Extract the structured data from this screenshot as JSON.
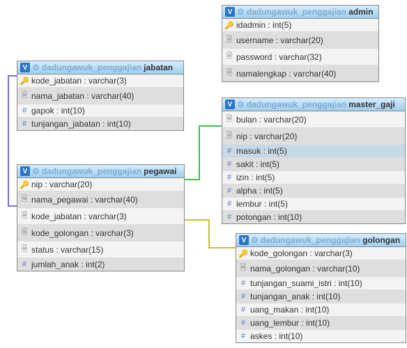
{
  "schema_label": "dadungawuk_penggajian",
  "iconset": {
    "key": "🔑",
    "text": "📄",
    "num": "#"
  },
  "tables": {
    "admin": {
      "schema": "dadungawuk_penggajian",
      "name": "admin",
      "columns": [
        {
          "icon": "key",
          "label": "idadmin : int(5)"
        },
        {
          "icon": "text",
          "label": "username : varchar(20)"
        },
        {
          "icon": "text",
          "label": "password : varchar(32)"
        },
        {
          "icon": "text",
          "label": "namalengkap : varchar(40)"
        }
      ]
    },
    "jabatan": {
      "schema": "dadungawuk_penggajian",
      "name": "jabatan",
      "columns": [
        {
          "icon": "key",
          "label": "kode_jabatan : varchar(3)"
        },
        {
          "icon": "text",
          "label": "nama_jabatan : varchar(40)"
        },
        {
          "icon": "num",
          "label": "gapok : int(10)"
        },
        {
          "icon": "num",
          "label": "tunjangan_jabatan : int(10)"
        }
      ]
    },
    "master_gaji": {
      "schema": "dadungawuk_penggajian",
      "name": "master_gaji",
      "columns": [
        {
          "icon": "text",
          "label": "bulan : varchar(20)"
        },
        {
          "icon": "text",
          "label": "nip : varchar(20)"
        },
        {
          "icon": "num",
          "label": "masuk : int(5)",
          "highlight": true
        },
        {
          "icon": "num",
          "label": "sakit : int(5)"
        },
        {
          "icon": "num",
          "label": "izin : int(5)"
        },
        {
          "icon": "num",
          "label": "alpha : int(5)"
        },
        {
          "icon": "num",
          "label": "lembur : int(5)"
        },
        {
          "icon": "num",
          "label": "potongan : int(10)"
        }
      ]
    },
    "pegawai": {
      "schema": "dadungawuk_penggajian",
      "name": "pegawai",
      "columns": [
        {
          "icon": "key",
          "label": "nip : varchar(20)"
        },
        {
          "icon": "text",
          "label": "nama_pegawai : varchar(40)"
        },
        {
          "icon": "text",
          "label": "kode_jabatan : varchar(3)"
        },
        {
          "icon": "text",
          "label": "kode_golongan : varchar(3)"
        },
        {
          "icon": "text",
          "label": "status : varchar(15)"
        },
        {
          "icon": "num",
          "label": "jumlah_anak : int(2)"
        }
      ]
    },
    "golongan": {
      "schema": "dadungawuk_penggajian",
      "name": "golongan",
      "columns": [
        {
          "icon": "key",
          "label": "kode_golongan : varchar(3)"
        },
        {
          "icon": "text",
          "label": "nama_golongan : varchar(10)"
        },
        {
          "icon": "num",
          "label": "tunjangan_suami_istri : int(10)"
        },
        {
          "icon": "num",
          "label": "tunjangan_anak : int(10)"
        },
        {
          "icon": "num",
          "label": "uang_makan : int(10)"
        },
        {
          "icon": "num",
          "label": "uang_lembur : int(10)"
        },
        {
          "icon": "num",
          "label": "askes : int(10)"
        }
      ]
    }
  },
  "chart_data": {
    "type": "table",
    "description": "Entity-relationship diagram",
    "schema": "dadungawuk_penggajian",
    "entities": [
      "admin",
      "jabatan",
      "master_gaji",
      "pegawai",
      "golongan"
    ],
    "relations": [
      {
        "from": "pegawai.kode_jabatan",
        "to": "jabatan.kode_jabatan"
      },
      {
        "from": "master_gaji.nip",
        "to": "pegawai.nip"
      },
      {
        "from": "pegawai.kode_golongan",
        "to": "golongan.kode_golongan"
      }
    ]
  }
}
